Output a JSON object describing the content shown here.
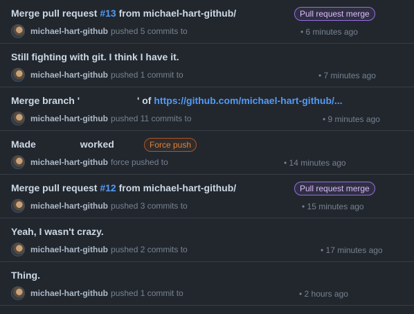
{
  "events": [
    {
      "title_prefix": "Merge pull request ",
      "pr_link": "#13",
      "title_suffix": " from michael-hart-github/",
      "label": "Pull request merge",
      "user": "michael-hart-github",
      "action": "pushed 5 commits to",
      "time": "• 6 minutes ago"
    },
    {
      "title": "Still fighting with git. I think I have it.",
      "user": "michael-hart-github",
      "action": "pushed 1 commit to",
      "time": "• 7 minutes ago"
    },
    {
      "title_prefix": "Merge branch '",
      "title_mid": "' of ",
      "link": "https://github.com/michael-hart-github/...",
      "user": "michael-hart-github",
      "action": "pushed 11 commits to",
      "time": "• 9 minutes ago"
    },
    {
      "title_prefix": "Made",
      "title_suffix": "worked",
      "label": "Force push",
      "user": "michael-hart-github",
      "action": "force pushed to",
      "time": "• 14 minutes ago"
    },
    {
      "title_prefix": "Merge pull request ",
      "pr_link": "#12",
      "title_suffix": " from michael-hart-github/",
      "label": "Pull request merge",
      "user": "michael-hart-github",
      "action": "pushed 3 commits to",
      "time": "• 15 minutes ago"
    },
    {
      "title": "Yeah, I wasn't crazy.",
      "user": "michael-hart-github",
      "action": "pushed 2 commits to",
      "time": "• 17 minutes ago"
    },
    {
      "title": "Thing.",
      "user": "michael-hart-github",
      "action": "pushed 1 commit to",
      "time": "• 2 hours ago"
    }
  ],
  "colors": {
    "background": "#22272e",
    "link": "#539bf5",
    "merge_label": "#986ee2",
    "force_push_label": "#ae5622"
  }
}
